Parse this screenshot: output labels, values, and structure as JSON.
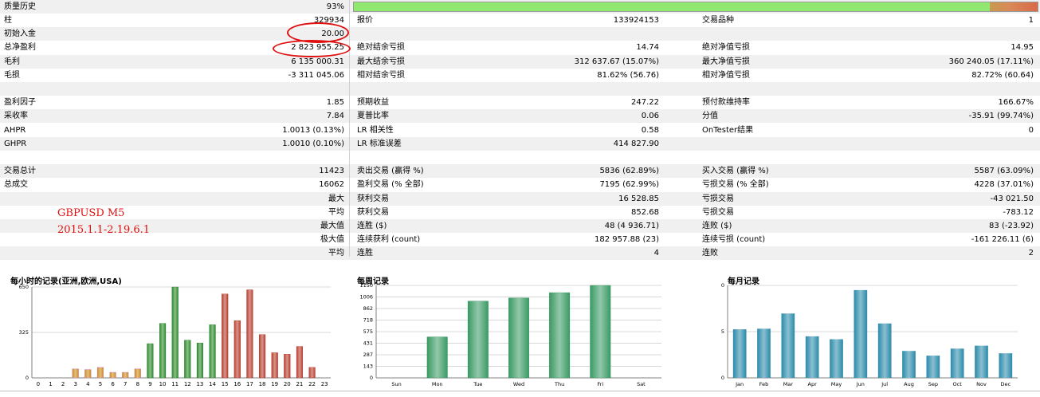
{
  "quality": {
    "label": "质量历史",
    "value": "93%",
    "fraction": 0.93
  },
  "colors": {
    "green_bar": "#90e870",
    "annotation": "#e01010",
    "hourly_green": "#2e8a2e",
    "hourly_orange": "#cc8a1c",
    "hourly_red": "#b84030",
    "weekly": "#3a9a64",
    "monthly": "#2a8aaa"
  },
  "rows": [
    {
      "c1l": "柱",
      "c1v": "329934",
      "c2l": "报价",
      "c2v": "133924153",
      "c3l": "交易品种",
      "c3v": "1"
    },
    {
      "c1l": "初始入金",
      "c1v": "20.00",
      "c2l": "",
      "c2v": "",
      "c3l": "",
      "c3v": ""
    },
    {
      "c1l": "总净盈利",
      "c1v": "2 823 955.25",
      "c2l": "绝对结余亏损",
      "c2v": "14.74",
      "c3l": "绝对净值亏损",
      "c3v": "14.95"
    },
    {
      "c1l": "毛利",
      "c1v": "6 135 000.31",
      "c2l": "最大结余亏损",
      "c2v": "312 637.67 (15.07%)",
      "c3l": "最大净值亏损",
      "c3v": "360 240.05 (17.11%)"
    },
    {
      "c1l": "毛损",
      "c1v": "-3 311 045.06",
      "c2l": "相对结余亏损",
      "c2v": "81.62% (56.76)",
      "c3l": "相对净值亏损",
      "c3v": "82.72% (60.64)"
    },
    {
      "c1l": "",
      "c1v": "",
      "c2l": "",
      "c2v": "",
      "c3l": "",
      "c3v": ""
    },
    {
      "c1l": "盈利因子",
      "c1v": "1.85",
      "c2l": "预期收益",
      "c2v": "247.22",
      "c3l": "预付款维持率",
      "c3v": "166.67%"
    },
    {
      "c1l": "采收率",
      "c1v": "7.84",
      "c2l": "夏普比率",
      "c2v": "0.06",
      "c3l": "分值",
      "c3v": "-35.91 (99.74%)"
    },
    {
      "c1l": "AHPR",
      "c1v": "1.0013 (0.13%)",
      "c2l": "LR 相关性",
      "c2v": "0.58",
      "c3l": "OnTester结果",
      "c3v": "0"
    },
    {
      "c1l": "GHPR",
      "c1v": "1.0010 (0.10%)",
      "c2l": "LR 标准误差",
      "c2v": "414 827.90",
      "c3l": "",
      "c3v": ""
    },
    {
      "c1l": "",
      "c1v": "",
      "c2l": "",
      "c2v": "",
      "c3l": "",
      "c3v": ""
    },
    {
      "c1l": "交易总计",
      "c1v": "11423",
      "c2l": "卖出交易 (赢得 %)",
      "c2v": "5836 (62.89%)",
      "c3l": "买入交易 (赢得 %)",
      "c3v": "5587 (63.09%)"
    },
    {
      "c1l": "总成交",
      "c1v": "16062",
      "c2l": "盈利交易 (% 全部)",
      "c2v": "7195 (62.99%)",
      "c3l": "亏损交易 (% 全部)",
      "c3v": "4228 (37.01%)"
    },
    {
      "c1l": "",
      "c1v": "最大",
      "c2l": "获利交易",
      "c2v": "16 528.85",
      "c3l": "亏损交易",
      "c3v": "-43 021.50"
    },
    {
      "c1l": "",
      "c1v": "平均",
      "c2l": "获利交易",
      "c2v": "852.68",
      "c3l": "亏损交易",
      "c3v": "-783.12"
    },
    {
      "c1l": "",
      "c1v": "最大值",
      "c2l": "连胜 ($)",
      "c2v": "48 (4 936.71)",
      "c3l": "连败 ($)",
      "c3v": "83 (-23.92)"
    },
    {
      "c1l": "",
      "c1v": "极大值",
      "c2l": "连续获利 (count)",
      "c2v": "182 957.88 (23)",
      "c3l": "连续亏损 (count)",
      "c3v": "-161 226.11 (6)"
    },
    {
      "c1l": "",
      "c1v": "平均",
      "c2l": "连胜",
      "c2v": "4",
      "c3l": "连败",
      "c3v": "2"
    }
  ],
  "annotation": {
    "line1": "GBPUSD  M5",
    "line2": "2015.1.1-2.19.6.1"
  },
  "chart_data": [
    {
      "type": "bar",
      "title": "每小时的记录(亚洲,欧洲,USA)",
      "categories": [
        "0",
        "1",
        "2",
        "3",
        "4",
        "5",
        "6",
        "7",
        "8",
        "9",
        "10",
        "11",
        "12",
        "13",
        "14",
        "15",
        "16",
        "17",
        "18",
        "19",
        "20",
        "21",
        "22",
        "23"
      ],
      "values": [
        0,
        0,
        0,
        65,
        60,
        75,
        40,
        40,
        65,
        245,
        390,
        650,
        270,
        250,
        380,
        600,
        410,
        630,
        310,
        180,
        170,
        225,
        75,
        0
      ],
      "ylim": [
        0,
        650
      ],
      "yticks": [
        "0",
        "325",
        "650"
      ]
    },
    {
      "type": "bar",
      "title": "每周记录",
      "categories": [
        "Sun",
        "Mon",
        "Tue",
        "Wed",
        "Thu",
        "Fri",
        "Sat"
      ],
      "values": [
        0,
        510,
        955,
        995,
        1060,
        1150,
        0
      ],
      "ylim": [
        0,
        1150
      ],
      "yticks": [
        "0",
        "143",
        "287",
        "431",
        "575",
        "718",
        "862",
        "1006",
        "1150"
      ]
    },
    {
      "type": "bar",
      "title": "每月记录",
      "categories": [
        "Jan",
        "Feb",
        "Mar",
        "Apr",
        "May",
        "Jun",
        "Jul",
        "Aug",
        "Sep",
        "Oct",
        "Nov",
        "Dec"
      ],
      "values": [
        415,
        420,
        550,
        355,
        330,
        750,
        465,
        230,
        190,
        250,
        275,
        210
      ],
      "ylim": [
        0,
        790
      ],
      "yticks": [
        "0",
        "395",
        "790"
      ]
    }
  ]
}
